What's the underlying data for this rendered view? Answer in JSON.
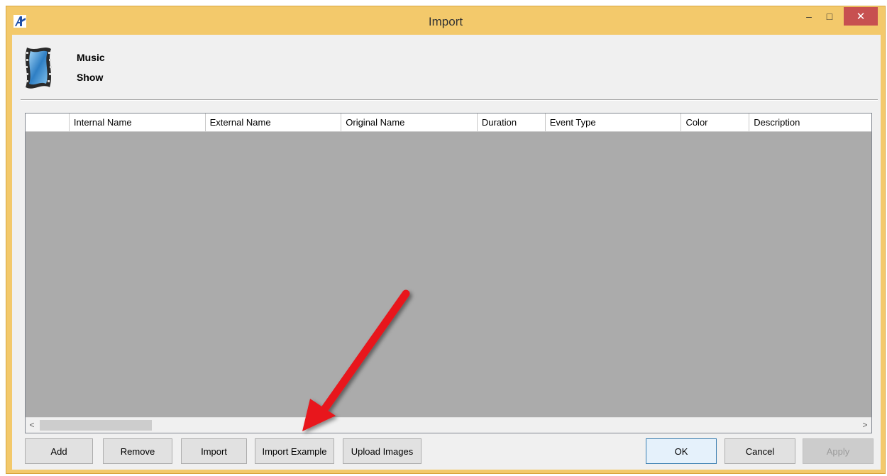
{
  "window": {
    "title": "Import",
    "minimize_glyph": "–",
    "maximize_glyph": "□",
    "close_glyph": "✕",
    "accent_color": "#f3c96b",
    "close_color": "#c75050"
  },
  "header": {
    "line1": "Music",
    "line2": "Show",
    "icon": "film-strip-icon"
  },
  "grid": {
    "columns": [
      "",
      "Internal Name",
      "External Name",
      "Original Name",
      "Duration",
      "Event Type",
      "Color",
      "Description"
    ],
    "rows": [],
    "scroll_left_glyph": "<",
    "scroll_right_glyph": ">"
  },
  "buttons": {
    "add": "Add",
    "remove": "Remove",
    "import": "Import",
    "import_example": "Import Example",
    "upload_images": "Upload Images",
    "ok": "OK",
    "cancel": "Cancel",
    "apply": "Apply"
  },
  "annotation": {
    "arrow_color": "#e8161b",
    "points_to": "import_example"
  }
}
